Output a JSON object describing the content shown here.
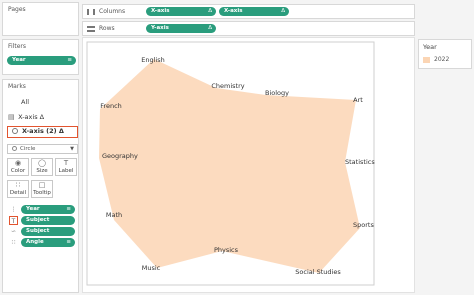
{
  "panels": {
    "pages": "Pages",
    "filters": "Filters",
    "marks": "Marks"
  },
  "filters": {
    "pill": "Year"
  },
  "marks": {
    "all": "All",
    "xaxis_row": "X-axis Δ",
    "active_row": "X-axis (2) Δ",
    "mark_type": "Circle",
    "tiles": [
      "Color",
      "Size",
      "Label",
      "Detail",
      "Tooltip"
    ],
    "fields": [
      "Year",
      "Subject",
      "Subject",
      "Angle"
    ]
  },
  "shelves": {
    "columns_label": "Columns",
    "rows_label": "Rows",
    "columns": [
      "X-axis",
      "X-axis"
    ],
    "rows": [
      "Y-axis"
    ],
    "delta": "Δ"
  },
  "legend": {
    "title": "Year",
    "items": [
      "2022"
    ]
  },
  "colors": {
    "fill": "#fbd5b4",
    "pill": "#2a9d7d",
    "highlight": "#e2542f"
  },
  "chart_data": {
    "type": "area",
    "points": [
      {
        "label": "English"
      },
      {
        "label": "Chemistry"
      },
      {
        "label": "Biology"
      },
      {
        "label": "Art"
      },
      {
        "label": "Statistics"
      },
      {
        "label": "Sports"
      },
      {
        "label": "Social Studies"
      },
      {
        "label": "Physics"
      },
      {
        "label": "Music"
      },
      {
        "label": "Math"
      },
      {
        "label": "Geography"
      },
      {
        "label": "French"
      }
    ]
  }
}
